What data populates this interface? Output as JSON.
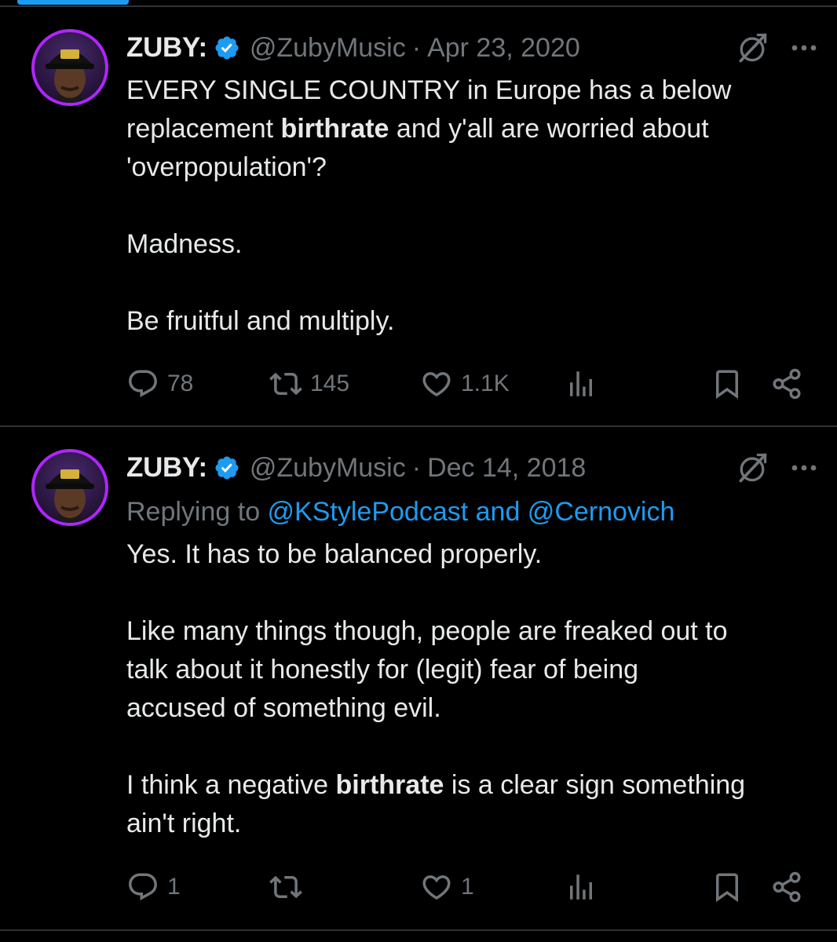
{
  "colors": {
    "background": "#000000",
    "text": "#e7e9ea",
    "muted": "#71767b",
    "link": "#1d9bf0",
    "verified": "#1d9bf0",
    "avatar_ring": "#b025ff",
    "divider": "#2f3336"
  },
  "tweets": [
    {
      "display_name": "ZUBY:",
      "handle": "@ZubyMusic",
      "separator": "·",
      "date": "Apr 23, 2020",
      "body": {
        "l1_a": "EVERY SINGLE COUNTRY in Europe has a below",
        "l2_a": "replacement ",
        "l2_bold": "birthrate",
        "l2_b": " and y'all are worried about",
        "l3": "'overpopulation'?",
        "p2": "Madness.",
        "p3": "Be fruitful and multiply."
      },
      "stats": {
        "replies": "78",
        "retweets": "145",
        "likes": "1.1K"
      },
      "icons": [
        "verified-badge-icon",
        "grok-icon",
        "more-icon",
        "reply-icon",
        "retweet-icon",
        "like-icon",
        "views-icon",
        "bookmark-icon",
        "share-icon"
      ]
    },
    {
      "display_name": "ZUBY:",
      "handle": "@ZubyMusic",
      "separator": "·",
      "date": "Dec 14, 2018",
      "reply_to": {
        "prefix": "Replying to ",
        "users": "@KStylePodcast and @Cernovich"
      },
      "body": {
        "p1": "Yes. It has to be balanced properly.",
        "p2_l1": "Like many things though, people are freaked out to",
        "p2_l2": "talk about it honestly for (legit) fear of being",
        "p2_l3": "accused of something evil.",
        "p3_l1_a": "I think a negative ",
        "p3_l1_bold": "birthrate",
        "p3_l1_b": " is a clear sign something",
        "p3_l2": "ain't right."
      },
      "stats": {
        "replies": "1",
        "retweets": "",
        "likes": "1"
      },
      "icons": [
        "verified-badge-icon",
        "grok-icon",
        "more-icon",
        "reply-icon",
        "retweet-icon",
        "like-icon",
        "views-icon",
        "bookmark-icon",
        "share-icon"
      ]
    }
  ]
}
